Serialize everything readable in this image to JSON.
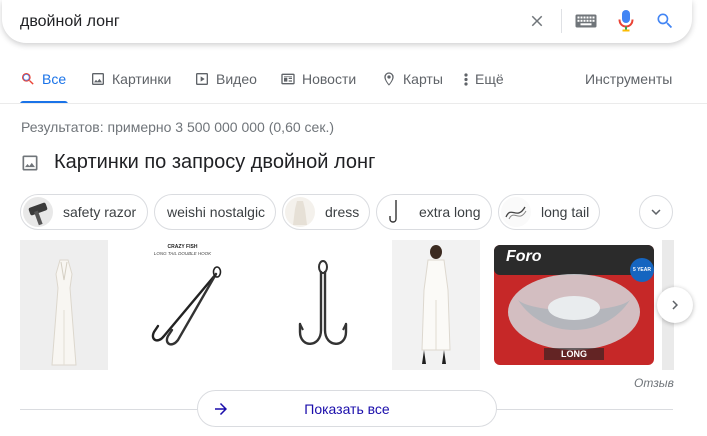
{
  "search": {
    "query": "двойной лонг"
  },
  "tabs": [
    {
      "label": "Все",
      "icon": "search-icon",
      "active": true
    },
    {
      "label": "Картинки",
      "icon": "image-icon"
    },
    {
      "label": "Видео",
      "icon": "video-icon"
    },
    {
      "label": "Новости",
      "icon": "news-icon"
    },
    {
      "label": "Карты",
      "icon": "map-pin-icon"
    },
    {
      "label": "Ещё",
      "icon": "more-vert-icon"
    }
  ],
  "tools_label": "Инструменты",
  "result_stats": "Результатов: примерно 3 500 000 000 (0,60 сек.)",
  "images_section": {
    "title": "Картинки по запросу двойной лонг",
    "chips": [
      {
        "label": "safety razor"
      },
      {
        "label": "weishi nostalgic"
      },
      {
        "label": "dress"
      },
      {
        "label": "extra long"
      },
      {
        "label": "long tail"
      }
    ],
    "thumbnails": [
      {
        "caption": ""
      },
      {
        "caption_title": "CRAZY FISH",
        "caption_sub": "LONG TAIL DOUBLE HOOK"
      },
      {
        "caption": ""
      },
      {
        "caption": ""
      },
      {
        "brand": "Foro",
        "badge": "5 YEAR",
        "label": "LONG"
      }
    ]
  },
  "feedback_label": "Отзыв",
  "show_all_label": "Показать все",
  "colors": {
    "accent": "#1a73e8",
    "link": "#1a0dab",
    "secondary_text": "#70757a",
    "mic_red": "#ea4335",
    "mic_yellow": "#fbbc04",
    "mic_green": "#34a853"
  }
}
